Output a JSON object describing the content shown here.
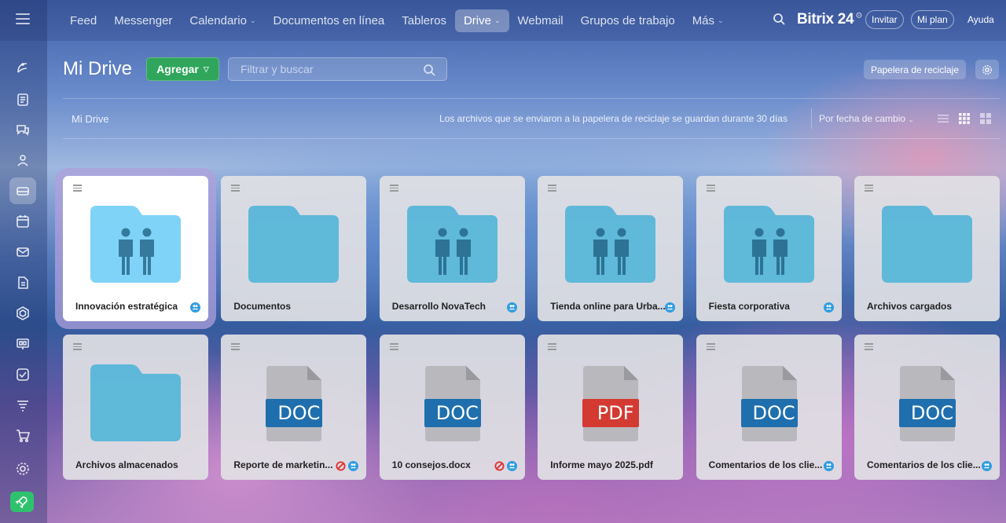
{
  "topnav": {
    "items": [
      {
        "label": "Feed",
        "dropdown": false,
        "active": false
      },
      {
        "label": "Messenger",
        "dropdown": false,
        "active": false
      },
      {
        "label": "Calendario",
        "dropdown": true,
        "active": false
      },
      {
        "label": "Documentos en línea",
        "dropdown": false,
        "active": false
      },
      {
        "label": "Tableros",
        "dropdown": false,
        "active": false
      },
      {
        "label": "Drive",
        "dropdown": true,
        "active": true
      },
      {
        "label": "Webmail",
        "dropdown": false,
        "active": false
      },
      {
        "label": "Grupos de trabajo",
        "dropdown": false,
        "active": false
      },
      {
        "label": "Más",
        "dropdown": true,
        "active": false
      }
    ],
    "brand": "Bitrix 24",
    "invite_label": "Invitar",
    "plan_label": "Mi plan",
    "help_label": "Ayuda"
  },
  "sidebar": {
    "icons": [
      "feed-icon",
      "tasks-icon",
      "chat-icon",
      "contacts-icon",
      "drive-icon",
      "calendar-icon",
      "mail-icon",
      "document-icon",
      "hexagon-icon",
      "board-icon",
      "checkbox-icon",
      "filter-icon",
      "cart-icon",
      "settings-icon",
      "rocket-icon"
    ],
    "active_index": 4
  },
  "toolbar": {
    "title": "Mi Drive",
    "add_label": "Agregar",
    "search_placeholder": "Filtrar y buscar",
    "trash_label": "Papelera de reciclaje"
  },
  "infobar": {
    "breadcrumb": "Mi Drive",
    "notice": "Los archivos que se enviaron a la papelera de reciclaje se guardan durante 30 días",
    "sort_label": "Por fecha de cambio"
  },
  "files": [
    {
      "name": "Innovación estratégica",
      "type": "folder-shared",
      "shared": true,
      "blocked": false,
      "selected": true
    },
    {
      "name": "Documentos",
      "type": "folder",
      "shared": false,
      "blocked": false,
      "selected": false
    },
    {
      "name": "Desarrollo NovaTech",
      "type": "folder-shared",
      "shared": true,
      "blocked": false,
      "selected": false
    },
    {
      "name": "Tienda online para Urba...",
      "type": "folder-shared",
      "shared": true,
      "blocked": false,
      "selected": false
    },
    {
      "name": "Fiesta corporativa",
      "type": "folder-shared",
      "shared": true,
      "blocked": false,
      "selected": false
    },
    {
      "name": "Archivos cargados",
      "type": "folder",
      "shared": false,
      "blocked": false,
      "selected": false
    },
    {
      "name": "Archivos almacenados",
      "type": "folder",
      "shared": false,
      "blocked": false,
      "selected": false
    },
    {
      "name": "Reporte de marketin...",
      "type": "doc",
      "ext": "DOC",
      "shared": true,
      "blocked": true,
      "selected": false
    },
    {
      "name": "10 consejos.docx",
      "type": "doc",
      "ext": "DOC",
      "shared": true,
      "blocked": true,
      "selected": false
    },
    {
      "name": "Informe mayo 2025.pdf",
      "type": "pdf",
      "ext": "PDF",
      "shared": false,
      "blocked": false,
      "selected": false
    },
    {
      "name": "Comentarios de los clie...",
      "type": "doc",
      "ext": "DOC",
      "shared": true,
      "blocked": false,
      "selected": false
    },
    {
      "name": "Comentarios de los clie...",
      "type": "doc",
      "ext": "DOC",
      "shared": true,
      "blocked": false,
      "selected": false
    }
  ],
  "colors": {
    "add_button": "#2fa65b",
    "folder_shared_active": "#7fd3f7",
    "folder_muted": "#5fb8d9",
    "doc_badge": "#1f6fae",
    "pdf_badge": "#d33a32",
    "share_badge": "#2f9ce0"
  }
}
